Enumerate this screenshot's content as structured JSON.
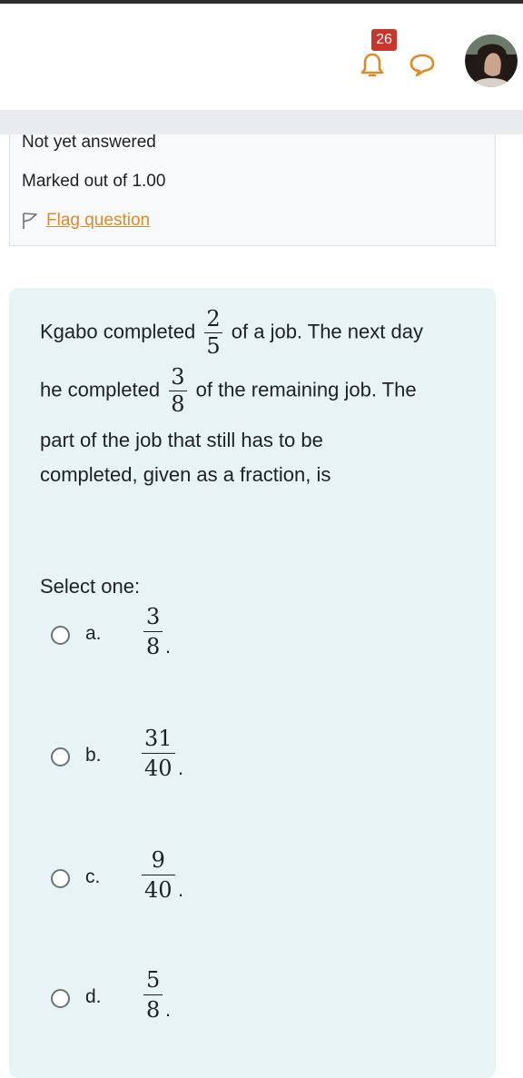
{
  "navbar": {
    "notification_count": "26",
    "icons": [
      "bell-icon",
      "chat-icon",
      "avatar"
    ]
  },
  "info": {
    "state": "Not yet answered",
    "mark": "Marked out of 1.00",
    "flag_label": "Flag question"
  },
  "question": {
    "line1_before": "Kgabo completed",
    "frac1_num": "2",
    "frac1_den": "5",
    "line1_after": "of a job. The next day",
    "line2_before": "he completed",
    "frac2_num": "3",
    "frac2_den": "8",
    "line2_after": "of the remaining job. The",
    "line3": "part of the job that still has to be",
    "line4": "completed, given as a fraction, is",
    "prompt": "Select one:",
    "options": [
      {
        "letter": "a.",
        "num": "3",
        "den": "8",
        "suffix": "."
      },
      {
        "letter": "b.",
        "num": "31",
        "den": "40",
        "suffix": "."
      },
      {
        "letter": "c.",
        "num": "9",
        "den": "40",
        "suffix": "."
      },
      {
        "letter": "d.",
        "num": "5",
        "den": "8",
        "suffix": "."
      }
    ]
  },
  "colors": {
    "accent": "#e08a26",
    "badge": "#c8352a",
    "card_bg": "#e7f3f5"
  }
}
